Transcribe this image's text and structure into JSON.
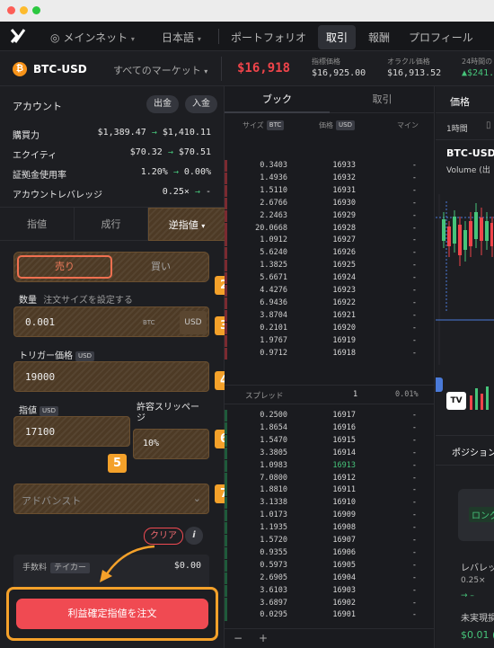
{
  "nav": {
    "network": "メインネット",
    "language": "日本語",
    "portfolio": "ポートフォリオ",
    "trade": "取引",
    "rewards": "報酬",
    "profile": "プロフィール"
  },
  "market": {
    "pair": "BTC-USD",
    "all_markets": "すべてのマーケット",
    "price": "$16,918",
    "index_label": "指標価格",
    "index_value": "$16,925.00",
    "oracle_label": "オラクル価格",
    "oracle_value": "$16,913.52",
    "change_label": "24時間の",
    "change_value": "▲$241."
  },
  "account": {
    "title": "アカウント",
    "withdraw": "出金",
    "deposit": "入金",
    "rows": [
      {
        "label": "購買力",
        "from": "$1,389.47",
        "to": "$1,410.11"
      },
      {
        "label": "エクイティ",
        "from": "$70.32",
        "to": "$70.51"
      },
      {
        "label": "証拠金使用率",
        "from": "1.20%",
        "to": "0.00%"
      },
      {
        "label": "アカウントレバレッジ",
        "from": "0.25×",
        "to": "-"
      }
    ]
  },
  "order_tabs": {
    "limit": "指値",
    "market": "成行",
    "stop_limit": "逆指値"
  },
  "side": {
    "sell": "売り",
    "buy": "買い"
  },
  "amount": {
    "label": "数量",
    "hint": "注文サイズを設定する",
    "value": "0.001",
    "btc": "BTC",
    "usd": "USD"
  },
  "trigger": {
    "label": "トリガー価格",
    "unit": "USD",
    "value": "19000"
  },
  "limit": {
    "label": "指値",
    "unit": "USD",
    "value": "17100"
  },
  "slippage": {
    "label": "許容スリッページ",
    "value": "10%"
  },
  "advanced": {
    "label": "アドバンスト"
  },
  "clear": "クリア",
  "info": "i",
  "fee": {
    "label": "手数料",
    "tag": "テイカー",
    "value": "$0.00"
  },
  "submit": "利益確定指値を注文",
  "badges": [
    "1",
    "2",
    "3",
    "4",
    "5",
    "6",
    "7"
  ],
  "book": {
    "tab_book": "ブック",
    "tab_trades": "取引",
    "col_size": "サイズ",
    "col_size_unit": "BTC",
    "col_price": "価格",
    "col_price_unit": "USD",
    "col_mine": "マイン",
    "asks": [
      {
        "size": "0.3403",
        "price": "16933",
        "mine": "-"
      },
      {
        "size": "1.4936",
        "price": "16932",
        "mine": "-"
      },
      {
        "size": "1.5110",
        "price": "16931",
        "mine": "-"
      },
      {
        "size": "2.6766",
        "price": "16930",
        "mine": "-"
      },
      {
        "size": "2.2463",
        "price": "16929",
        "mine": "-"
      },
      {
        "size": "20.0668",
        "price": "16928",
        "mine": "-"
      },
      {
        "size": "1.0912",
        "price": "16927",
        "mine": "-"
      },
      {
        "size": "5.6240",
        "price": "16926",
        "mine": "-"
      },
      {
        "size": "1.3825",
        "price": "16925",
        "mine": "-"
      },
      {
        "size": "5.6671",
        "price": "16924",
        "mine": "-"
      },
      {
        "size": "4.4276",
        "price": "16923",
        "mine": "-"
      },
      {
        "size": "6.9436",
        "price": "16922",
        "mine": "-"
      },
      {
        "size": "3.8704",
        "price": "16921",
        "mine": "-"
      },
      {
        "size": "0.2101",
        "price": "16920",
        "mine": "-"
      },
      {
        "size": "1.9767",
        "price": "16919",
        "mine": "-"
      },
      {
        "size": "0.9712",
        "price": "16918",
        "mine": "-"
      }
    ],
    "spread_label": "スプレッド",
    "spread_value": "1",
    "spread_pct": "0.01%",
    "bids": [
      {
        "size": "0.2500",
        "price": "16917",
        "mine": "-"
      },
      {
        "size": "1.8654",
        "price": "16916",
        "mine": "-"
      },
      {
        "size": "1.5470",
        "price": "16915",
        "mine": "-"
      },
      {
        "size": "3.3805",
        "price": "16914",
        "mine": "-"
      },
      {
        "size": "1.0983",
        "price": "16913",
        "mine": "-"
      },
      {
        "size": "7.0800",
        "price": "16912",
        "mine": "-"
      },
      {
        "size": "1.8810",
        "price": "16911",
        "mine": "-"
      },
      {
        "size": "3.1338",
        "price": "16910",
        "mine": "-"
      },
      {
        "size": "1.0173",
        "price": "16909",
        "mine": "-"
      },
      {
        "size": "1.1935",
        "price": "16908",
        "mine": "-"
      },
      {
        "size": "1.5720",
        "price": "16907",
        "mine": "-"
      },
      {
        "size": "0.9355",
        "price": "16906",
        "mine": "-"
      },
      {
        "size": "0.5973",
        "price": "16905",
        "mine": "-"
      },
      {
        "size": "2.6905",
        "price": "16904",
        "mine": "-"
      },
      {
        "size": "3.6103",
        "price": "16903",
        "mine": "-"
      },
      {
        "size": "3.6897",
        "price": "16902",
        "mine": "-"
      },
      {
        "size": "0.0295",
        "price": "16901",
        "mine": "-"
      }
    ],
    "minus": "−",
    "plus": "+"
  },
  "chart_panel": {
    "tab_price": "価格",
    "interval": "1時間",
    "pair": "BTC-USD",
    "volume": "Volume (出",
    "logo": "TV"
  },
  "positions": {
    "title": "ポジション",
    "long": "ロング",
    "leverage": "レバレッジ",
    "leverage_value": "0.25×",
    "arrow": "→ –",
    "unrealized": "未実現損",
    "unrealized_value": "$0.01 ("
  },
  "colors": {
    "accent_orange": "#f4a12a",
    "price_red": "#f0444a",
    "bid_green": "#46c47a",
    "submit_red": "#f04a52"
  }
}
